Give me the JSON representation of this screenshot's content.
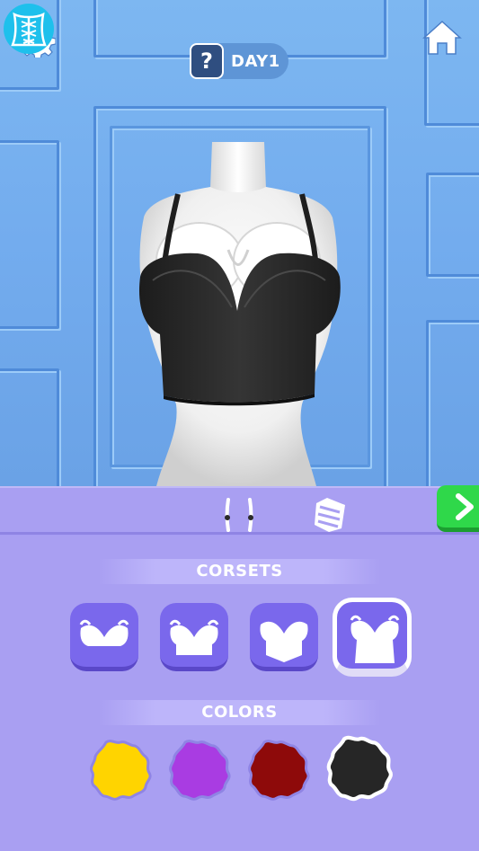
{
  "header": {
    "settings_icon": "gear-icon",
    "home_icon": "home-icon",
    "hint_symbol": "?",
    "day_label": "DAY1"
  },
  "tabs": [
    {
      "icon": "corset-lacing-icon",
      "active": true
    },
    {
      "icon": "straps-icon",
      "active": false
    },
    {
      "icon": "pattern-icon",
      "active": false
    }
  ],
  "next_icon": "chevron-right-icon",
  "sections": {
    "corsets_title": "CORSETS",
    "colors_title": "COLORS"
  },
  "corset_options": [
    {
      "style": "short-cups",
      "selected": false
    },
    {
      "style": "cropped",
      "selected": false
    },
    {
      "style": "pointed-hem",
      "selected": false
    },
    {
      "style": "long-line",
      "selected": true
    }
  ],
  "color_options": [
    {
      "hex": "#ffd400",
      "selected": false
    },
    {
      "hex": "#a93ce2",
      "selected": false
    },
    {
      "hex": "#8e0a0a",
      "selected": false
    },
    {
      "hex": "#262626",
      "selected": true
    }
  ],
  "colors": {
    "accent_purple": "#7a68ec",
    "active_tab": "#1ec0ec",
    "next_green": "#2fd84a"
  }
}
